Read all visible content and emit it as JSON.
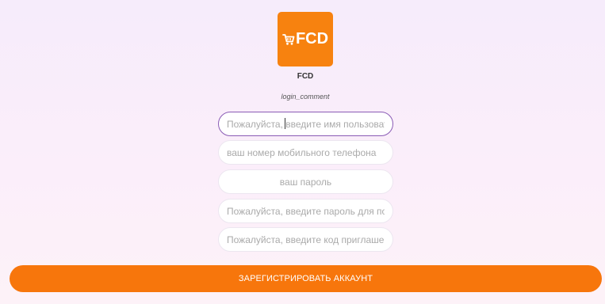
{
  "app": {
    "logo_text": "FCD",
    "name": "FCD",
    "comment": "login_comment"
  },
  "form": {
    "username_placeholder": "Пожалуйста, введите имя пользователя",
    "phone_placeholder": "ваш номер мобильного телефона",
    "password_placeholder": "ваш пароль",
    "password_confirm_placeholder": "Пожалуйста, введите пароль для подтверждения",
    "invite_code_placeholder": "Пожалуйста, введите код приглашения",
    "submit_label": "ЗАРЕГИСТРИРОВАТЬ АККАУНТ"
  },
  "colors": {
    "accent": "#f7760c",
    "focus_border": "#8a5bb5"
  },
  "icons": {
    "logo_icon": "shopping-cart-icon"
  }
}
